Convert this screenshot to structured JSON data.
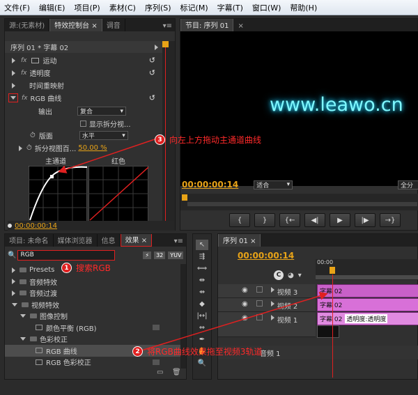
{
  "menu": [
    "文件(F)",
    "编辑(E)",
    "项目(P)",
    "素材(C)",
    "序列(S)",
    "标记(M)",
    "字幕(T)",
    "窗口(W)",
    "帮助(H)"
  ],
  "effect_controls": {
    "tabs": [
      "源:(无素材)",
      "特效控制台",
      "调音"
    ],
    "sequence": "序列 01 * 字幕 02",
    "items": [
      "运动",
      "透明度",
      "时间重映射",
      "RGB 曲线"
    ],
    "fx_label": "fx",
    "output_label": "输出",
    "output_value": "复合",
    "split_checkbox_label": "显示拆分视...",
    "layout_label": "版面",
    "layout_value": "水平",
    "split_percent_label": "拆分视图百...",
    "split_percent_value": "50.00 %",
    "curve_labels": [
      "主通道",
      "红色"
    ],
    "timecode": "00:00:00:14"
  },
  "program": {
    "tab": "节目: 序列 01",
    "video_text": "www.leawo.cn",
    "timecode": "00:00:00:14",
    "fit": "适合",
    "quality": "全分",
    "controls": [
      "{",
      "}",
      "{←",
      "◀|",
      "▶",
      "|▶",
      "→}"
    ]
  },
  "project": {
    "tabs": [
      "项目: 未命名",
      "媒体浏览器",
      "信息",
      "效果"
    ],
    "search_value": "RGB",
    "badges": [
      "32",
      "YUV"
    ],
    "tree": [
      {
        "label": "Presets",
        "level": 0,
        "open": false
      },
      {
        "label": "音频特效",
        "level": 0,
        "open": false
      },
      {
        "label": "音频过渡",
        "level": 0,
        "open": false
      },
      {
        "label": "视频特效",
        "level": 0,
        "open": true
      },
      {
        "label": "图像控制",
        "level": 1,
        "open": true
      },
      {
        "label": "颜色平衡 (RGB)",
        "level": 2,
        "item": true
      },
      {
        "label": "色彩校正",
        "level": 1,
        "open": true
      },
      {
        "label": "RGB 曲线",
        "level": 2,
        "item": true,
        "selected": true
      },
      {
        "label": "RGB 色彩校正",
        "level": 2,
        "item": true
      }
    ]
  },
  "sequence": {
    "tab": "序列 01",
    "timecode": "00:00:00:14",
    "ruler": "00:00",
    "tracks": [
      {
        "name": "视频 3",
        "clip": "字幕 02",
        "clip_extra": ""
      },
      {
        "name": "视频 2",
        "clip": "字幕 02",
        "clip_extra": ""
      },
      {
        "name": "视频 1",
        "clip": "字幕 02",
        "clip_extra": "透明度:透明度"
      }
    ],
    "audio_track": "音频 1"
  },
  "annotations": [
    {
      "num": "1",
      "text": "搜索RGB"
    },
    {
      "num": "2",
      "text": "将RGB曲线效果拖至视频3轨道"
    },
    {
      "num": "3",
      "text": "向左上方拖动主通道曲线"
    }
  ]
}
